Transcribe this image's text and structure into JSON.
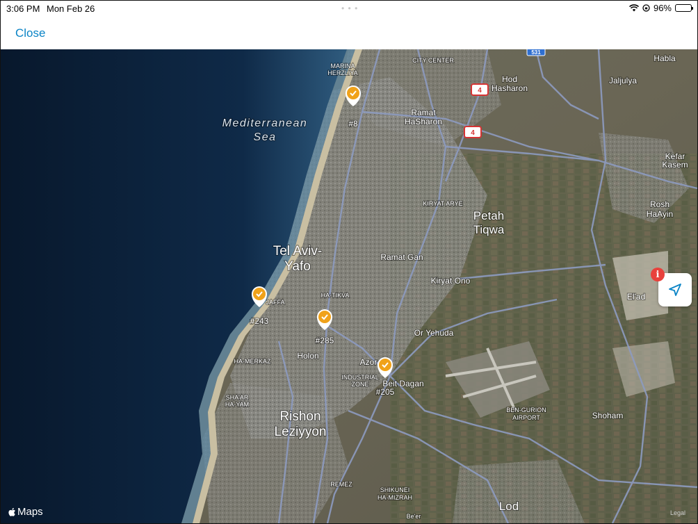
{
  "status_bar": {
    "time": "3:06 PM",
    "date": "Mon Feb 26",
    "battery": "96%",
    "battery_level": 0.96
  },
  "nav": {
    "close_label": "Close"
  },
  "map": {
    "sea_label_line1": "Mediterranean",
    "sea_label_line2": "Sea",
    "places": {
      "marina": "MARINA",
      "herzliya": "HERZLIYA",
      "city_center": "CITY CENTER",
      "hod_hasharon_1": "Hod",
      "hod_hasharon_2": "Hasharon",
      "jaljulya": "Jaljulya",
      "habla": "Habla",
      "ramat_hasharon_1": "Ramat",
      "ramat_hasharon_2": "HaSharon",
      "kefar_kasem_1": "Kefar",
      "kefar_kasem_2": "Kasem",
      "kiryat_arye": "KIRYAT ARYE",
      "petah_tiqwa_1": "Petah",
      "petah_tiqwa_2": "Tiqwa",
      "rosh_haayin_1": "Rosh",
      "rosh_haayin_2": "HaAyin",
      "tel_aviv_1": "Tel Aviv-",
      "tel_aviv_2": "Yafo",
      "ramat_gan": "Ramat Gan",
      "kiryat_ono": "Kiryat Ono",
      "elad": "El'ad",
      "jaffa": "JAFFA",
      "ha_tikva": "HA-TIKVA",
      "or_yehuda": "Or Yehuda",
      "holon": "Holon",
      "azor": "Azor",
      "ha_merkaz": "HA-MERKAZ",
      "industrial_zone_1": "INDUSTRIAL",
      "industrial_zone_2": "ZONE",
      "beit_dagan": "Beit Dagan",
      "shaar_hayam_1": "SHA'AR",
      "shaar_hayam_2": "HA-YAM",
      "rishon_1": "Rishon",
      "rishon_2": "Leziyyon",
      "ben_gurion_1": "BEN-GURION",
      "ben_gurion_2": "AIRPORT",
      "shoham": "Shoham",
      "remez": "REMEZ",
      "shikunei_1": "SHIKUNEI",
      "shikunei_2": "HA-MIZRAH",
      "beer_yaakov": "Be'er",
      "lod": "Lod"
    },
    "road_shields": [
      "4",
      "4",
      "531"
    ],
    "pins": [
      {
        "label": "#8",
        "status": "checked"
      },
      {
        "label": "#243",
        "status": "checked"
      },
      {
        "label": "#285",
        "status": "checked"
      },
      {
        "label": "#205",
        "status": "checked"
      }
    ],
    "location_badge": "i",
    "attribution": "Maps",
    "legal": "Legal"
  },
  "colors": {
    "accent": "#0a84c6",
    "pin": "#f0a21a",
    "badge": "#e8413c"
  }
}
